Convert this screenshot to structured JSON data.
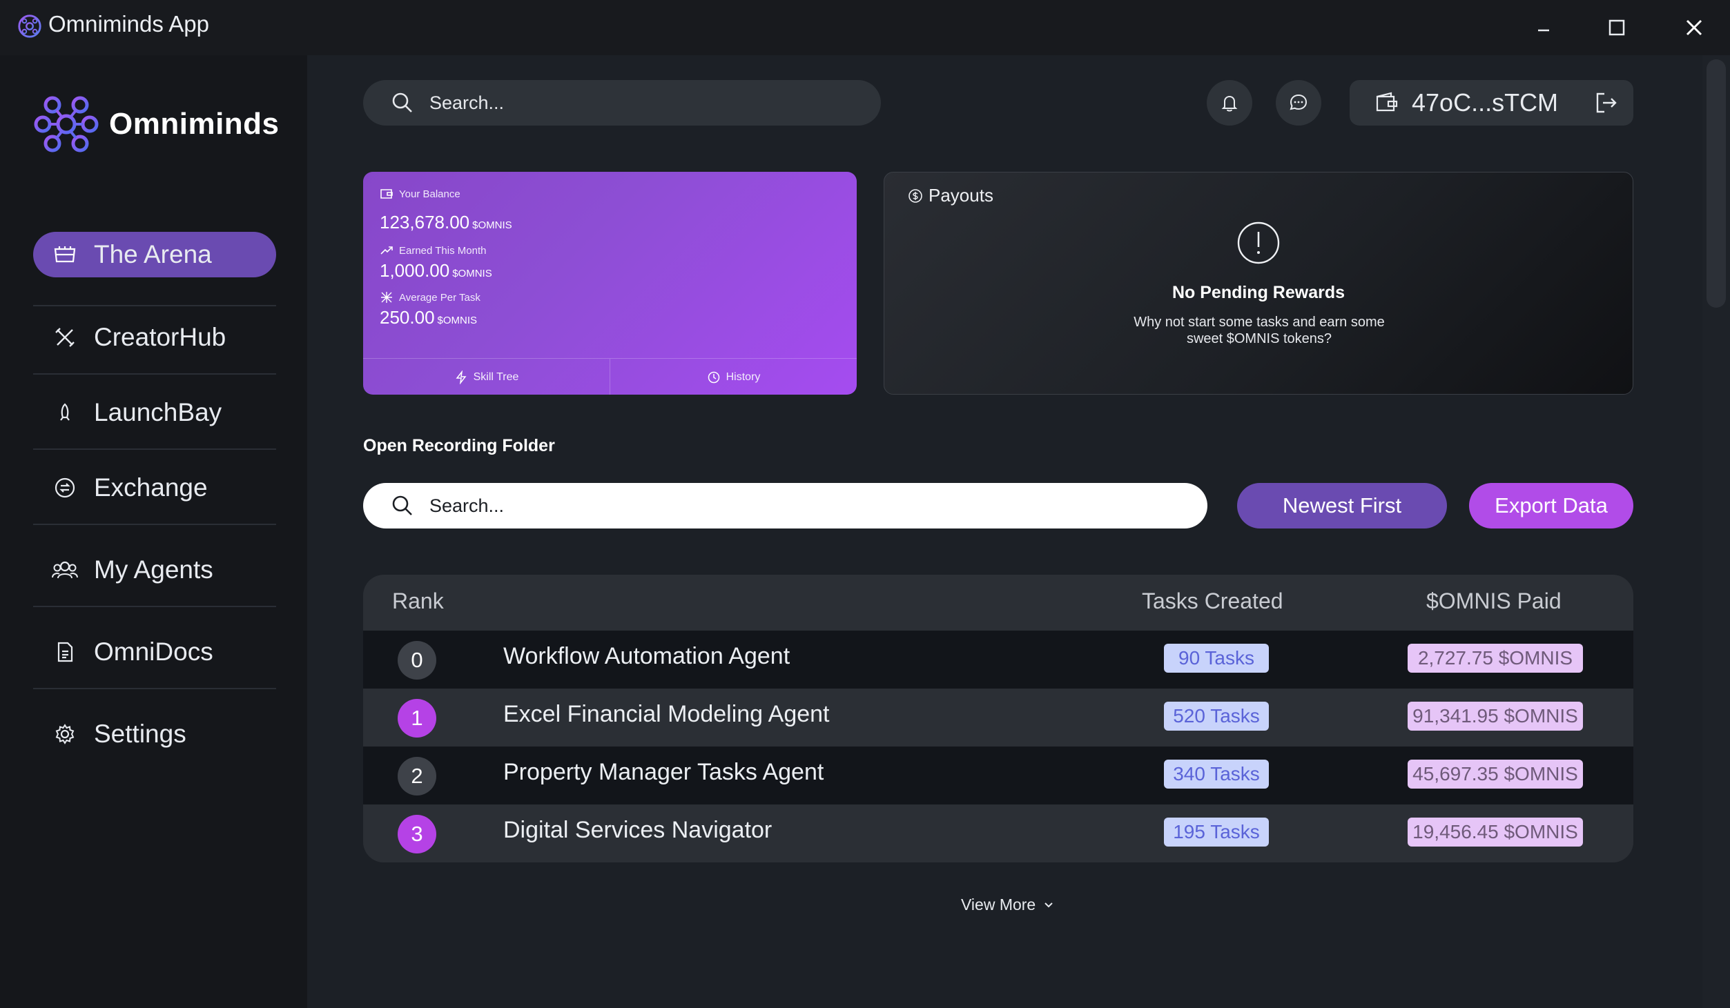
{
  "window": {
    "title": "Omniminds App",
    "controls": {
      "minimize": "minimize-icon",
      "maximize": "maximize-icon",
      "close": "close-icon"
    }
  },
  "sidebar": {
    "brand": "Omniminds",
    "items": [
      {
        "label": "The Arena",
        "icon": "arena-icon",
        "active": true
      },
      {
        "label": "CreatorHub",
        "icon": "tools-icon"
      },
      {
        "label": "LaunchBay",
        "icon": "rocket-icon"
      },
      {
        "label": "Exchange",
        "icon": "exchange-icon"
      },
      {
        "label": "My Agents",
        "icon": "users-icon"
      },
      {
        "label": "OmniDocs",
        "icon": "document-icon"
      },
      {
        "label": "Settings",
        "icon": "gear-icon"
      }
    ]
  },
  "header": {
    "search_placeholder": "Search...",
    "wallet_address": "47oC...sTCM"
  },
  "balance": {
    "title": "Your Balance",
    "balance_value": "123,678.00",
    "unit": "$OMNIS",
    "earned_label": "Earned This Month",
    "earned_value": "1,000.00",
    "avg_label": "Average Per Task",
    "avg_value": "250.00",
    "skill_tree": "Skill Tree",
    "history": "History"
  },
  "payouts": {
    "title": "Payouts",
    "headline": "No Pending Rewards",
    "message": "Why not start some tasks and earn some sweet $OMNIS tokens?"
  },
  "recordings": {
    "section_title": "Open Recording Folder",
    "search_placeholder": "Search...",
    "sort_label": "Newest First",
    "export_label": "Export Data"
  },
  "table": {
    "headers": {
      "rank": "Rank",
      "tasks": "Tasks Created",
      "paid": "$OMNIS Paid"
    },
    "rows": [
      {
        "rank": "0",
        "name": "Workflow Automation Agent",
        "tasks": "90 Tasks",
        "paid": "2,727.75 $OMNIS"
      },
      {
        "rank": "1",
        "name": "Excel Financial Modeling Agent",
        "tasks": "520 Tasks",
        "paid": "91,341.95 $OMNIS"
      },
      {
        "rank": "2",
        "name": "Property Manager Tasks Agent",
        "tasks": "340 Tasks",
        "paid": "45,697.35 $OMNIS"
      },
      {
        "rank": "3",
        "name": "Digital Services Navigator",
        "tasks": "195 Tasks",
        "paid": "19,456.45 $OMNIS"
      }
    ],
    "view_more": "View More"
  },
  "colors": {
    "accent_purple": "#6a4bb1",
    "accent_magenta": "#b14ce8",
    "background": "#1c2026",
    "sidebar": "#15171b"
  }
}
